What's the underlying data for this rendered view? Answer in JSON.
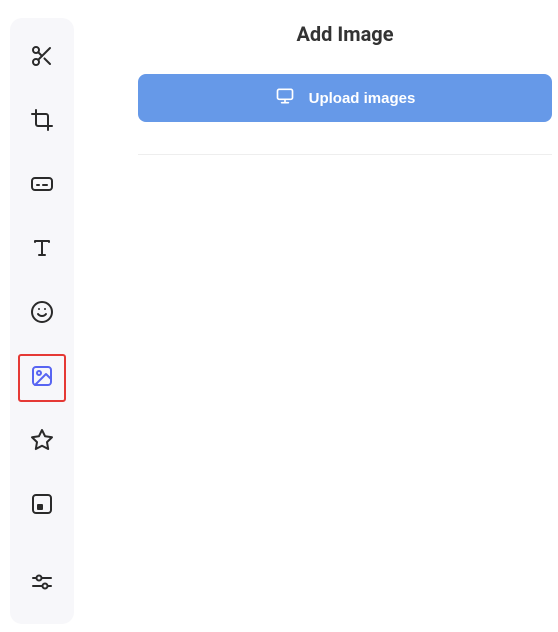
{
  "page_title": "Add Image",
  "upload_button_label": "Upload images",
  "sidebar": {
    "items": [
      {
        "name": "cut",
        "icon": "scissors-icon",
        "active": false
      },
      {
        "name": "crop",
        "icon": "crop-icon",
        "active": false
      },
      {
        "name": "captions",
        "icon": "captions-icon",
        "active": false
      },
      {
        "name": "text",
        "icon": "text-icon",
        "active": false
      },
      {
        "name": "emoji",
        "icon": "smile-icon",
        "active": false
      },
      {
        "name": "image",
        "icon": "image-icon",
        "active": true
      },
      {
        "name": "star",
        "icon": "star-icon",
        "active": false
      },
      {
        "name": "overlay",
        "icon": "overlay-icon",
        "active": false
      },
      {
        "name": "adjust",
        "icon": "sliders-icon",
        "active": false
      }
    ]
  },
  "colors": {
    "accent": "#6699e8",
    "highlight_border": "#e53935",
    "active_icon": "#5865f2"
  }
}
